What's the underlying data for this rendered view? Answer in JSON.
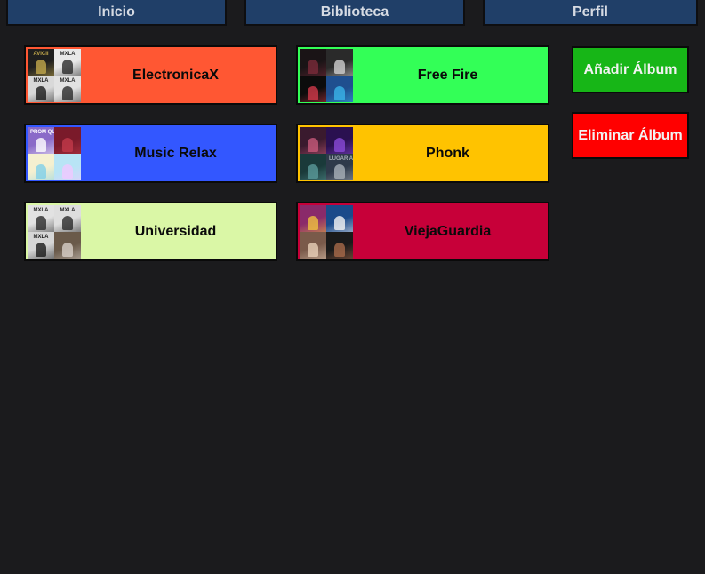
{
  "nav": {
    "tabs": [
      {
        "label": "Inicio"
      },
      {
        "label": "Biblioteca"
      },
      {
        "label": "Perfil"
      }
    ]
  },
  "albums": [
    {
      "name": "ElectronicaX",
      "color": "#ff5733",
      "cover": [
        {
          "bg": "#1e1e1e",
          "accent": "#c2a84b",
          "text": "AVICII"
        },
        {
          "bg": "#e8e8e8",
          "accent": "#2a2a2a",
          "text": "MXLA"
        },
        {
          "bg": "#d9d9d9",
          "accent": "#1a1a1a",
          "text": "MXLA"
        },
        {
          "bg": "#e2e2e2",
          "accent": "#2a2a2a",
          "text": "MXLA"
        }
      ]
    },
    {
      "name": "Free Fire",
      "color": "#33ff57",
      "cover": [
        {
          "bg": "#1a1416",
          "accent": "#7a2a3a",
          "text": ""
        },
        {
          "bg": "#2a2a2a",
          "accent": "#cfcfcf",
          "text": ""
        },
        {
          "bg": "#0c0c0c",
          "accent": "#d13a4a",
          "text": ""
        },
        {
          "bg": "#1f4f8f",
          "accent": "#39b4e8",
          "text": ""
        }
      ]
    },
    {
      "name": "Music Relax",
      "color": "#3357ff",
      "cover": [
        {
          "bg": "#8a6ac8",
          "accent": "#ffffff",
          "text": "PROM QUEEN"
        },
        {
          "bg": "#7a1a2a",
          "accent": "#c23a4a",
          "text": ""
        },
        {
          "bg": "#f5f0d0",
          "accent": "#7fd0e8",
          "text": ""
        },
        {
          "bg": "#b8e4f5",
          "accent": "#f0c8ff",
          "text": ""
        }
      ]
    },
    {
      "name": "Phonk",
      "color": "#ffc300",
      "cover": [
        {
          "bg": "#3a1a2e",
          "accent": "#c85a7a",
          "text": ""
        },
        {
          "bg": "#2a1050",
          "accent": "#8a4ad8",
          "text": ""
        },
        {
          "bg": "#1a3a3a",
          "accent": "#5a9a9a",
          "text": ""
        },
        {
          "bg": "#2e3a4a",
          "accent": "#a8b0b8",
          "text": "LUGAR A SOS"
        }
      ]
    },
    {
      "name": "Universidad",
      "color": "#daf7a6",
      "cover": [
        {
          "bg": "#e2e2e2",
          "accent": "#2a2a2a",
          "text": "MXLA"
        },
        {
          "bg": "#dedede",
          "accent": "#2a2a2a",
          "text": "MXLA"
        },
        {
          "bg": "#d6d6d6",
          "accent": "#1a1a1a",
          "text": "MXLA"
        },
        {
          "bg": "#6a5a4a",
          "accent": "#d8d0c8",
          "text": ""
        }
      ]
    },
    {
      "name": "ViejaGuardia",
      "color": "#c70039",
      "cover": [
        {
          "bg": "#8a2a6a",
          "accent": "#f0c040",
          "text": ""
        },
        {
          "bg": "#1a4a8a",
          "accent": "#f5f5f5",
          "text": ""
        },
        {
          "bg": "#7a5a4a",
          "accent": "#e8d0b8",
          "text": ""
        },
        {
          "bg": "#1a1a1a",
          "accent": "#a86a4a",
          "text": ""
        }
      ]
    }
  ],
  "actions": {
    "add_label": "Añadir Álbum",
    "add_color": "#17b617",
    "remove_label": "Eliminar Álbum",
    "remove_color": "#ff0000"
  }
}
